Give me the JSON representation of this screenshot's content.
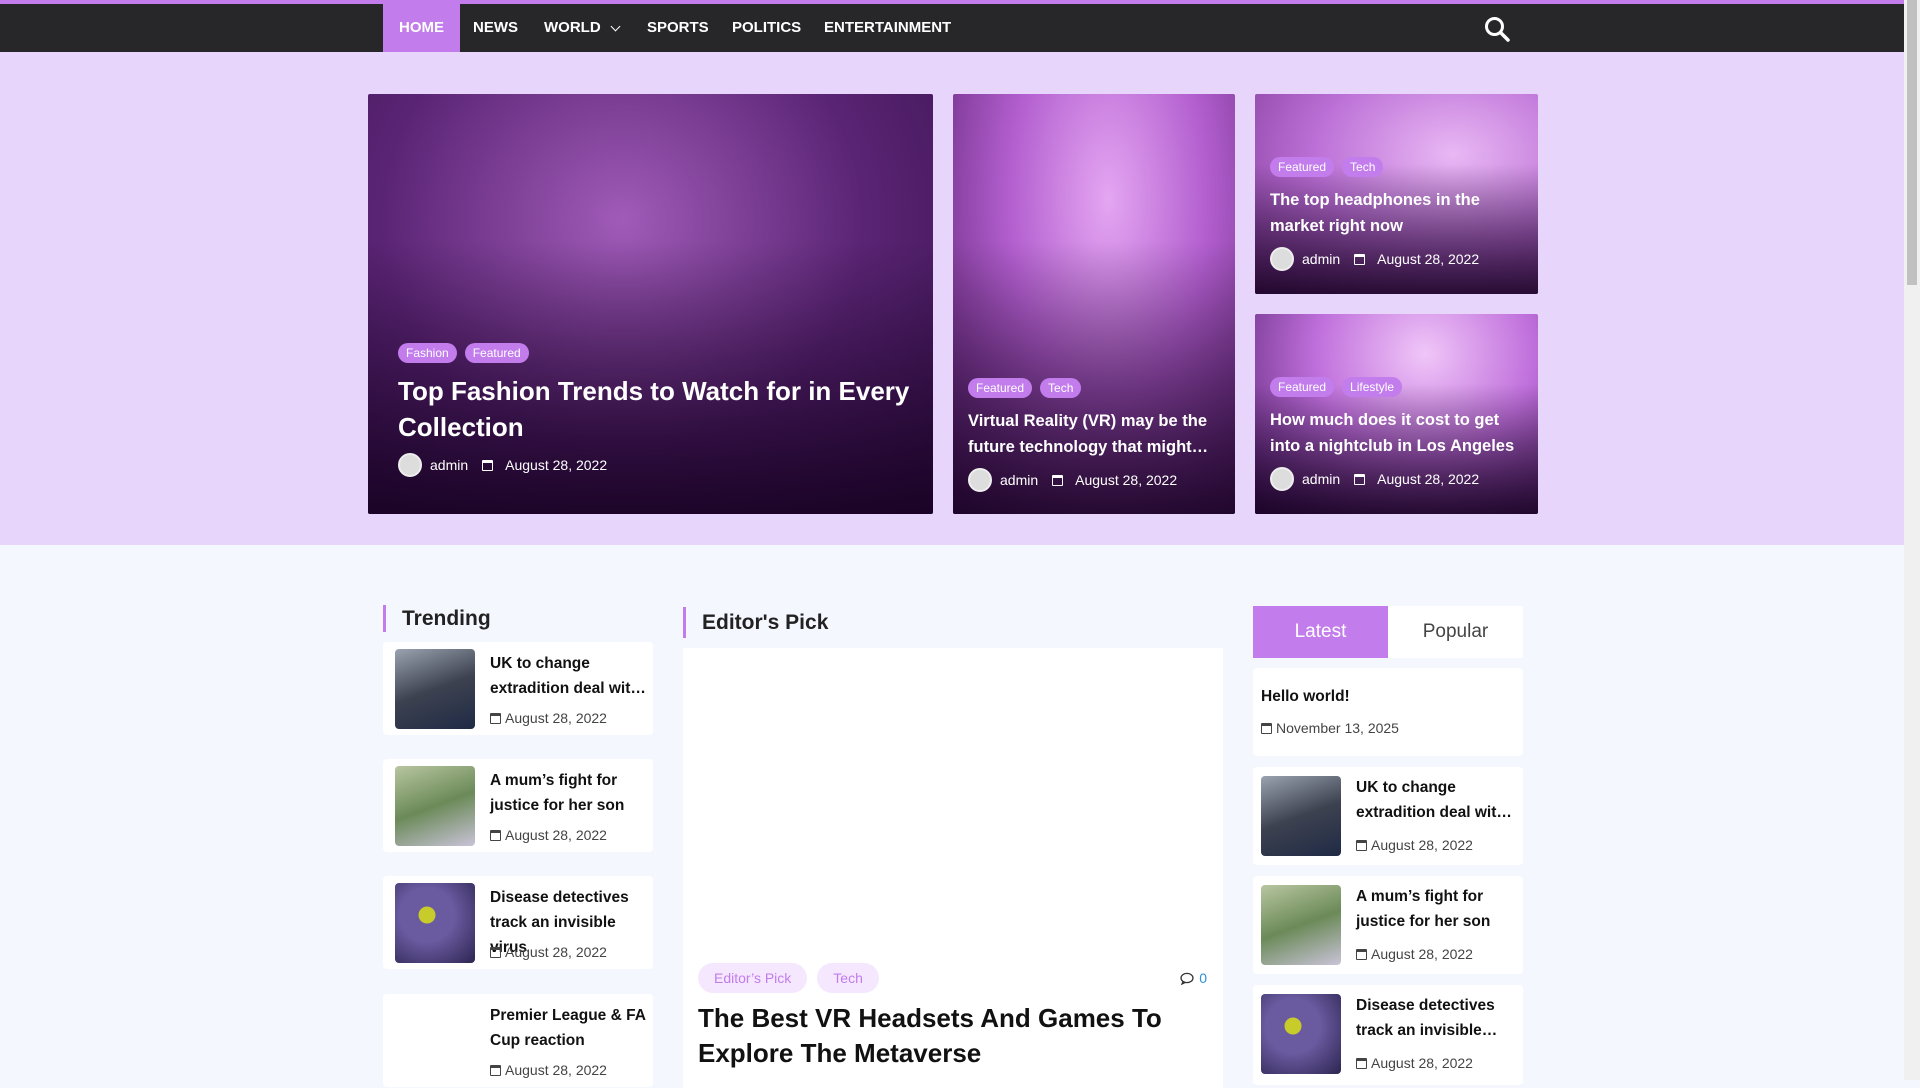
{
  "nav": {
    "items": [
      "HOME",
      "NEWS",
      "WORLD",
      "SPORTS",
      "POLITICS",
      "ENTERTAINMENT"
    ],
    "active": "HOME"
  },
  "colors": {
    "accent": "#c27cec",
    "nav_bg": "#27272a",
    "hero_bg": "#e8d5fb"
  },
  "hero": [
    {
      "tags": [
        "Fashion",
        "Featured"
      ],
      "title": "Top Fashion Trends to Watch for in Every Collection",
      "author": "admin",
      "date": "August 28, 2022"
    },
    {
      "tags": [
        "Featured",
        "Tech"
      ],
      "title": "Virtual Reality (VR) may be the future technology that might…",
      "author": "admin",
      "date": "August 28, 2022"
    },
    {
      "tags": [
        "Featured",
        "Tech"
      ],
      "title": "The top headphones in the market right now",
      "author": "admin",
      "date": "August 28, 2022"
    },
    {
      "tags": [
        "Featured",
        "Lifestyle"
      ],
      "title": "How much does it cost to get into a nightclub in Los Angeles",
      "author": "admin",
      "date": "August 28, 2022"
    }
  ],
  "trending": {
    "heading": "Trending",
    "items": [
      {
        "title": "UK to change extradition deal wit…",
        "date": "August 28, 2022"
      },
      {
        "title": "A mum’s fight for justice for her son",
        "date": "August 28, 2022"
      },
      {
        "title": "Disease detectives track an invisible virus",
        "date": "August 28, 2022"
      },
      {
        "title": "Premier League & FA Cup reaction",
        "date": "August 28, 2022"
      }
    ]
  },
  "editors": {
    "heading": "Editor's Pick",
    "tags": [
      "Editor’s Pick",
      "Tech"
    ],
    "comments": "0",
    "title": "The Best VR Headsets And Games To Explore The Metaverse"
  },
  "tabs": {
    "latest": "Latest",
    "popular": "Popular",
    "items": [
      {
        "title": "Hello world!",
        "date": "November 13, 2025"
      },
      {
        "title": "UK to change extradition deal wit…",
        "date": "August 28, 2022"
      },
      {
        "title": "A mum’s fight for justice for her son",
        "date": "August 28, 2022"
      },
      {
        "title": "Disease detectives track an invisible…",
        "date": "August 28, 2022"
      }
    ]
  }
}
